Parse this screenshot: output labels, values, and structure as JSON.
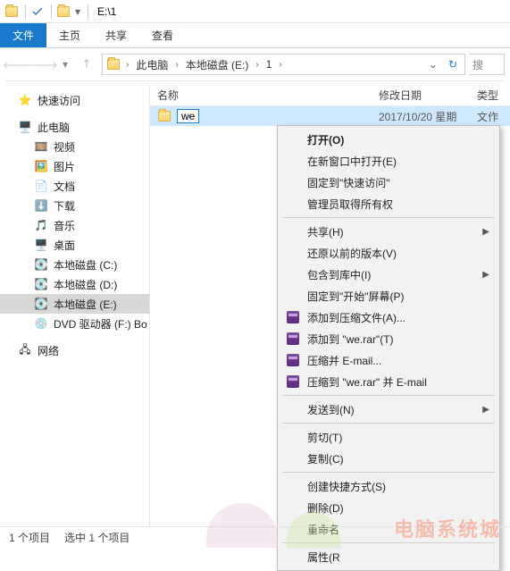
{
  "titlebar": {
    "path_text": "E:\\1"
  },
  "ribbon": {
    "file": "文件",
    "tabs": [
      "主页",
      "共享",
      "查看"
    ]
  },
  "address": {
    "crumbs": [
      "此电脑",
      "本地磁盘 (E:)",
      "1"
    ],
    "search_placeholder": "搜"
  },
  "sidebar": {
    "quick_access": "快速访问",
    "this_pc": "此电脑",
    "items": [
      {
        "label": "视频"
      },
      {
        "label": "图片"
      },
      {
        "label": "文档"
      },
      {
        "label": "下载"
      },
      {
        "label": "音乐"
      },
      {
        "label": "桌面"
      },
      {
        "label": "本地磁盘 (C:)"
      },
      {
        "label": "本地磁盘 (D:)"
      },
      {
        "label": "本地磁盘 (E:)"
      },
      {
        "label": "DVD 驱动器 (F:) Bo"
      }
    ],
    "network": "网络"
  },
  "columns": {
    "name": "名称",
    "modified": "修改日期",
    "type": "类型"
  },
  "file": {
    "name": "we",
    "modified": "2017/10/20 星期",
    "type": "文作"
  },
  "ctx": {
    "open": "打开(O)",
    "open_new_window": "在新窗口中打开(E)",
    "pin_quick": "固定到\"快速访问\"",
    "admin_owner": "管理员取得所有权",
    "share": "共享(H)",
    "restore": "还原以前的版本(V)",
    "include_lib": "包含到库中(I)",
    "pin_start": "固定到\"开始\"屏幕(P)",
    "add_archive": "添加到压缩文件(A)...",
    "add_to_rar": "添加到 \"we.rar\"(T)",
    "compress_email": "压缩并 E-mail...",
    "compress_to_email": "压缩到 \"we.rar\" 并 E-mail",
    "send_to": "发送到(N)",
    "cut": "剪切(T)",
    "copy": "复制(C)",
    "shortcut": "创建快捷方式(S)",
    "delete": "删除(D)",
    "rename": "重命名",
    "properties": "属性(R"
  },
  "status": {
    "count": "1 个项目",
    "selected": "选中 1 个项目"
  },
  "watermark": "电脑系统城"
}
